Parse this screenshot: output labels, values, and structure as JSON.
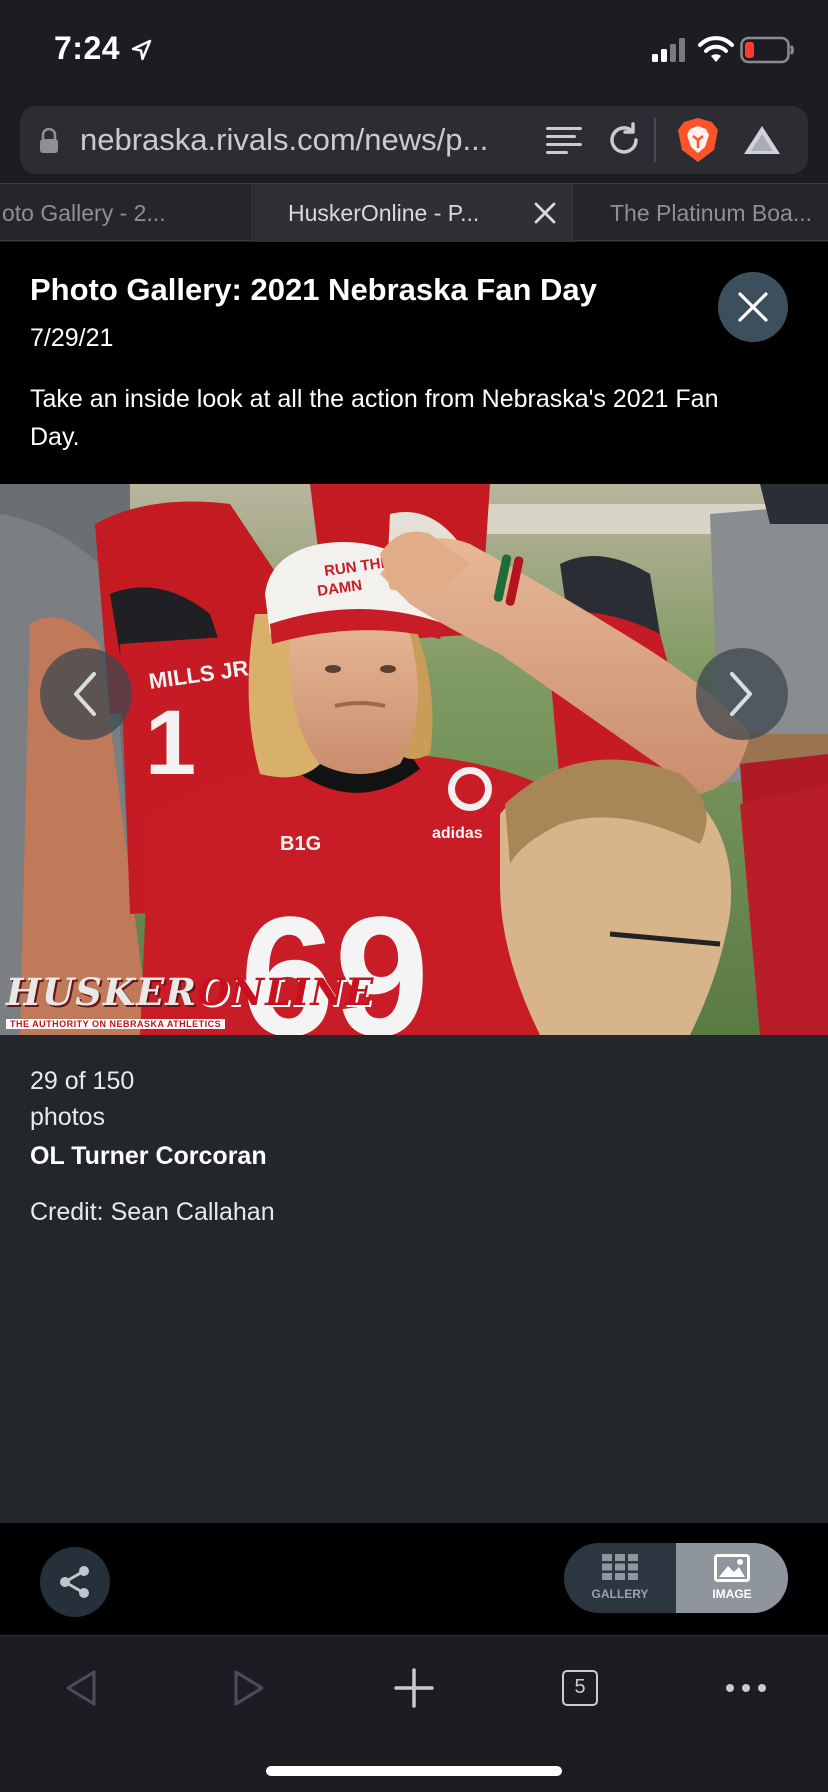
{
  "status_bar": {
    "time": "7:24"
  },
  "url_bar": {
    "url": "nebraska.rivals.com/news/p..."
  },
  "tabs": [
    {
      "label": "oto Gallery - 2..."
    },
    {
      "label": "HuskerOnline - P..."
    },
    {
      "label": "The Platinum Boa..."
    }
  ],
  "gallery": {
    "title": "Photo Gallery: 2021 Nebraska Fan Day",
    "date": "7/29/21",
    "description": "Take an inside look at all the action from Nebraska's 2021 Fan Day."
  },
  "photo": {
    "watermark_part1": "HUSKER",
    "watermark_part2": "ONLINE",
    "watermark_tagline": "THE AUTHORITY ON NEBRASKA ATHLETICS",
    "cap_text_1": "RUN THE",
    "cap_text_2": "DAMN",
    "jersey_number": "69",
    "jersey_brand": "adidas",
    "jersey_logo": "B1G",
    "background_jersey_number": "1",
    "background_jersey_name": "MILLS JR."
  },
  "caption": {
    "count_line_1": "29 of 150",
    "count_line_2": "photos",
    "title": "OL Turner Corcoran",
    "credit": "Credit: Sean Callahan"
  },
  "footer": {
    "gallery_label": "GALLERY",
    "image_label": "IMAGE"
  },
  "toolbar": {
    "tab_count": "5"
  },
  "colors": {
    "background": "#1c1d22",
    "header_bg": "#000000",
    "caption_bg": "#23262a",
    "husker_red": "#c8101e"
  }
}
